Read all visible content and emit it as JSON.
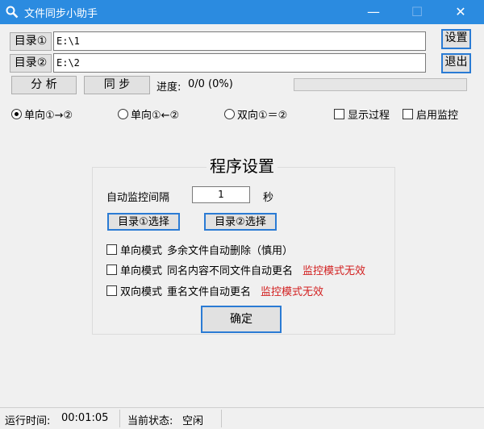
{
  "window": {
    "title": "文件同步小助手",
    "minimize_glyph": "—",
    "maximize_glyph": "☐",
    "close_glyph": "✕",
    "accent_color": "#2b8be0"
  },
  "dirs": {
    "dir1_button": "目录①",
    "dir1_value": "E:\\1",
    "dir2_button": "目录②",
    "dir2_value": "E:\\2"
  },
  "side_buttons": {
    "settings": "设置",
    "exit": "退出"
  },
  "actions": {
    "analyze": "分 析",
    "sync": "同 步",
    "progress_label": "进度:",
    "progress_text": "0/0 (0%)",
    "progress_fraction": 0
  },
  "modes": {
    "one_way_forward": "单向①→②",
    "one_way_backward": "单向①←②",
    "two_way": "双向①＝②",
    "selected": "one_way_forward",
    "show_process": "显示过程",
    "enable_monitor": "启用监控"
  },
  "settings_panel": {
    "title": "程序设置",
    "interval_label": "自动监控间隔",
    "interval_value": "1",
    "interval_unit": "秒",
    "select_dir1": "目录①选择",
    "select_dir2": "目录②选择",
    "option1_mode": "单向模式",
    "option1_text": "多余文件自动删除（慎用）",
    "option2_mode": "单向模式",
    "option2_text": "同名内容不同文件自动更名",
    "option2_note": "监控模式无效",
    "option3_mode": "双向模式",
    "option3_text": "重名文件自动更名",
    "option3_note": "监控模式无效",
    "confirm": "确定",
    "note_color": "#d21f1f"
  },
  "status": {
    "runtime_label": "运行时间:",
    "runtime_value": "00:01:05",
    "state_label": "当前状态:",
    "state_value": "空闲"
  },
  "icons": {
    "app": "magnifier-icon"
  }
}
